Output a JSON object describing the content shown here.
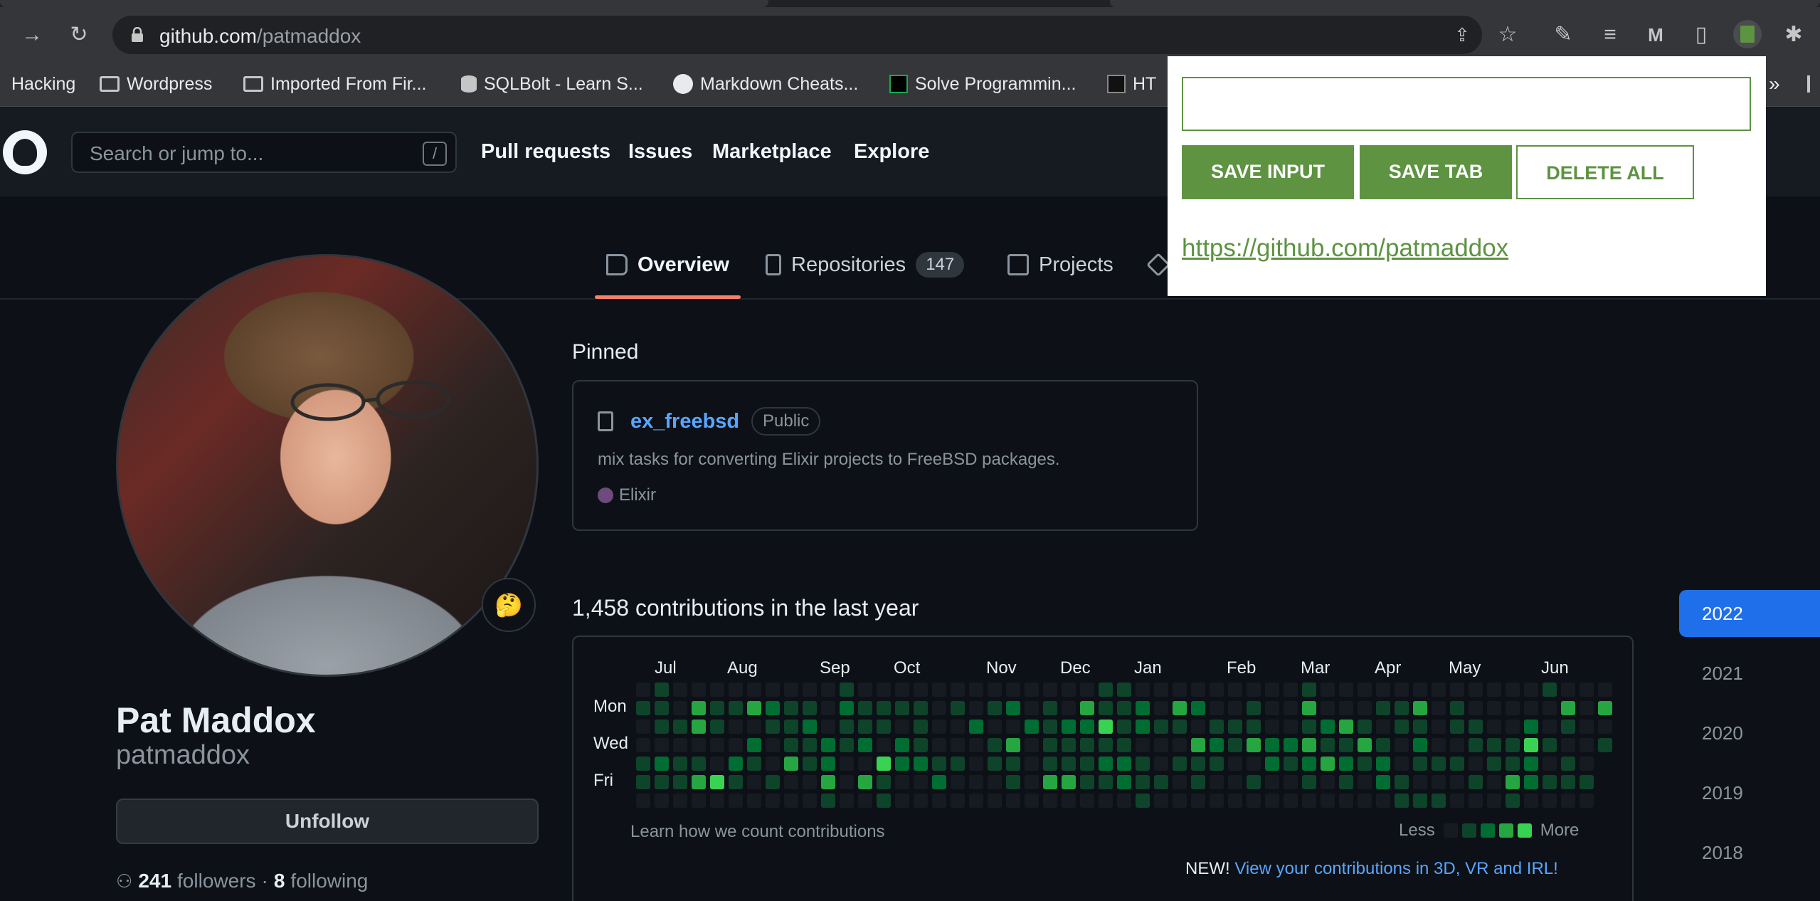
{
  "browser": {
    "url_host": "github.com",
    "url_path": "/patmaddox",
    "bookmarks": [
      {
        "label": "Hacking",
        "icon": "none"
      },
      {
        "label": "Wordpress",
        "icon": "folder-icon"
      },
      {
        "label": "Imported From Fir...",
        "icon": "folder-icon"
      },
      {
        "label": "SQLBolt - Learn S...",
        "icon": "database-icon"
      },
      {
        "label": "Markdown Cheats...",
        "icon": "github-icon"
      },
      {
        "label": "Solve Programmin...",
        "icon": "hackerrank-icon"
      },
      {
        "label": "HT",
        "icon": "html-icon"
      }
    ],
    "bookmarks_overflow": "»"
  },
  "header": {
    "search_placeholder": "Search or jump to...",
    "search_shortcut": "/",
    "nav": [
      "Pull requests",
      "Issues",
      "Marketplace",
      "Explore"
    ]
  },
  "tabs": {
    "overview": "Overview",
    "repositories": "Repositories",
    "repositories_count": "147",
    "projects": "Projects"
  },
  "profile": {
    "name": "Pat Maddox",
    "login": "patmaddox",
    "status_emoji": "🤔",
    "unfollow_label": "Unfollow",
    "followers_count": "241",
    "followers_label": "followers",
    "separator": "·",
    "following_count": "8",
    "following_label": "following"
  },
  "pinned": {
    "title": "Pinned",
    "repo_name": "ex_freebsd",
    "visibility": "Public",
    "description": "mix tasks for converting Elixir projects to FreeBSD packages.",
    "language": "Elixir",
    "language_color": "#6e4a7e"
  },
  "contributions": {
    "title": "1,458 contributions in the last year",
    "months": [
      "Jul",
      "Aug",
      "Sep",
      "Oct",
      "Nov",
      "Dec",
      "Jan",
      "Feb",
      "Mar",
      "Apr",
      "May",
      "Jun"
    ],
    "day_labels": [
      "Mon",
      "Wed",
      "Fri"
    ],
    "learn_link": "Learn how we count contributions",
    "legend_less": "Less",
    "legend_more": "More",
    "new_label": "NEW!",
    "new_link": "View your contributions in 3D, VR and IRL!",
    "level_colors": [
      "#161b22",
      "#0e4429",
      "#006d32",
      "#26a641",
      "#39d353"
    ]
  },
  "years": [
    "2022",
    "2021",
    "2020",
    "2019",
    "2018"
  ],
  "popup": {
    "input_value": "",
    "save_input": "SAVE INPUT",
    "save_tab": "SAVE TAB",
    "delete_all": "DELETE ALL",
    "saved_link": "https://github.com/patmaddox",
    "accent": "#5d9341"
  }
}
